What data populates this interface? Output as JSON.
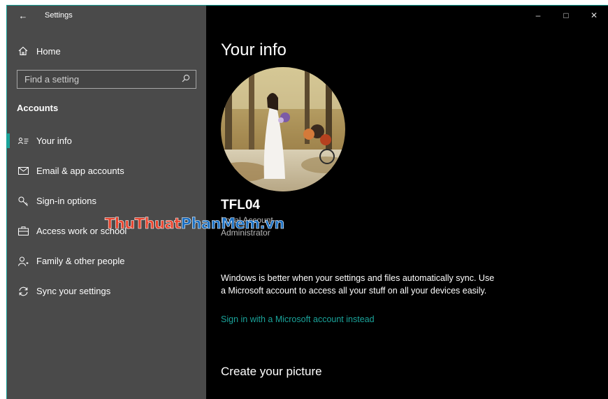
{
  "window": {
    "app_title": "Settings",
    "back_icon": "arrow-left-icon",
    "controls": [
      "minimize-icon",
      "maximize-icon",
      "close-icon"
    ],
    "accent": "#1aa39a",
    "sidebar_bg": "#4a4a4a",
    "main_bg": "#000000"
  },
  "sidebar": {
    "home_label": "Home",
    "search_placeholder": "Find a setting",
    "section_title": "Accounts",
    "items": [
      {
        "label": "Your info",
        "icon": "contact-card-icon",
        "selected": true
      },
      {
        "label": "Email & app accounts",
        "icon": "mail-icon"
      },
      {
        "label": "Sign-in options",
        "icon": "key-icon"
      },
      {
        "label": "Access work or school",
        "icon": "briefcase-icon"
      },
      {
        "label": "Family & other people",
        "icon": "person-add-icon"
      },
      {
        "label": "Sync your settings",
        "icon": "sync-icon"
      }
    ]
  },
  "main": {
    "title": "Your info",
    "account_name": "TFL04",
    "account_type": "Local Account",
    "account_role": "Administrator",
    "sync_message": "Windows is better when your settings and files automatically sync. Use a Microsoft account to access all your stuff on all your devices easily.",
    "ms_link": "Sign in with a Microsoft account instead",
    "create_picture": "Create your picture"
  },
  "watermark": {
    "part1": "ThuThuat",
    "part2": "PhanMem.vn"
  }
}
